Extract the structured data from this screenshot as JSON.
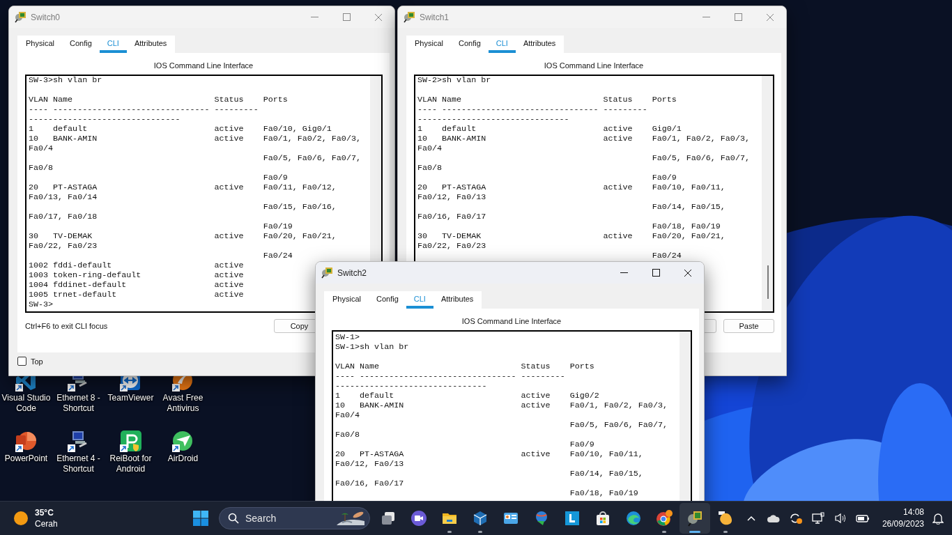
{
  "desktop": {
    "icons": [
      {
        "kind": "code-editor",
        "label": "Visual Studio Code"
      },
      {
        "kind": "network",
        "label": "Ethernet 8 - Shortcut"
      },
      {
        "kind": "remote",
        "label": "TeamViewer"
      },
      {
        "kind": "antivirus",
        "label": "Avast Free Antivirus"
      },
      {
        "kind": "slides",
        "label": "PowerPoint"
      },
      {
        "kind": "network",
        "label": "Ethernet 4 - Shortcut"
      },
      {
        "kind": "repair",
        "label": "ReiBoot for Android"
      },
      {
        "kind": "plane",
        "label": "AirDroid"
      }
    ]
  },
  "windows": [
    {
      "title": "Switch0",
      "active": false,
      "tabs": [
        {
          "label": "Physical",
          "selected": false
        },
        {
          "label": "Config",
          "selected": false
        },
        {
          "label": "CLI",
          "selected": true
        },
        {
          "label": "Attributes",
          "selected": false
        }
      ],
      "panel_title": "IOS Command Line Interface",
      "scrolled": true,
      "cli_lines": [
        {
          "text": "SW-3>sh vlan br"
        },
        {
          "vlan": "VLAN",
          "name": "Name",
          "status": "Status",
          "ports": "Ports"
        },
        {
          "text": "---- -------------------------------- ---------"
        },
        {
          "text": "-------------------------------"
        },
        {
          "vlan": "1",
          "name": "default",
          "status": "active",
          "ports": "Fa0/10, Gig0/1"
        },
        {
          "vlan": "10",
          "name": "BANK-AMIN",
          "status": "active",
          "ports": "Fa0/1, Fa0/2, Fa0/3,"
        },
        {
          "text": "Fa0/4"
        },
        {
          "ports": "Fa0/5, Fa0/6, Fa0/7,"
        },
        {
          "text": "Fa0/8"
        },
        {
          "ports": "Fa0/9"
        },
        {
          "vlan": "20",
          "name": "PT-ASTAGA",
          "status": "active",
          "ports": "Fa0/11, Fa0/12,"
        },
        {
          "text": "Fa0/13, Fa0/14"
        },
        {
          "ports": "Fa0/15, Fa0/16,"
        },
        {
          "text": "Fa0/17, Fa0/18"
        },
        {
          "ports": "Fa0/19"
        },
        {
          "vlan": "30",
          "name": "TV-DEMAK",
          "status": "active",
          "ports": "Fa0/20, Fa0/21,"
        },
        {
          "text": "Fa0/22, Fa0/23"
        },
        {
          "ports": "Fa0/24"
        },
        {
          "vlan": "1002",
          "name": "fddi-default",
          "status": "active"
        },
        {
          "vlan": "1003",
          "name": "token-ring-default",
          "status": "active"
        },
        {
          "vlan": "1004",
          "name": "fddinet-default",
          "status": "active"
        },
        {
          "vlan": "1005",
          "name": "trnet-default",
          "status": "active"
        },
        {
          "text": "SW-3>"
        }
      ],
      "hint": "Ctrl+F6 to exit CLI focus",
      "copy_button": "Copy",
      "top_checkbox": {
        "label": "Top",
        "checked": false
      }
    },
    {
      "title": "Switch1",
      "active": false,
      "tabs": [
        {
          "label": "Physical",
          "selected": false
        },
        {
          "label": "Config",
          "selected": false
        },
        {
          "label": "CLI",
          "selected": true
        },
        {
          "label": "Attributes",
          "selected": false
        }
      ],
      "panel_title": "IOS Command Line Interface",
      "scrolled": true,
      "cli_lines": [
        {
          "text": "SW-2>sh vlan br"
        },
        {
          "vlan": "VLAN",
          "name": "Name",
          "status": "Status",
          "ports": "Ports"
        },
        {
          "text": "---- -------------------------------- ---------"
        },
        {
          "text": "-------------------------------"
        },
        {
          "vlan": "1",
          "name": "default",
          "status": "active",
          "ports": "Gig0/1"
        },
        {
          "vlan": "10",
          "name": "BANK-AMIN",
          "status": "active",
          "ports": "Fa0/1, Fa0/2, Fa0/3,"
        },
        {
          "text": "Fa0/4"
        },
        {
          "ports": "Fa0/5, Fa0/6, Fa0/7,"
        },
        {
          "text": "Fa0/8"
        },
        {
          "ports": "Fa0/9"
        },
        {
          "vlan": "20",
          "name": "PT-ASTAGA",
          "status": "active",
          "ports": "Fa0/10, Fa0/11,"
        },
        {
          "text": "Fa0/12, Fa0/13"
        },
        {
          "ports": "Fa0/14, Fa0/15,"
        },
        {
          "text": "Fa0/16, Fa0/17"
        },
        {
          "ports": "Fa0/18, Fa0/19"
        },
        {
          "vlan": "30",
          "name": "TV-DEMAK",
          "status": "active",
          "ports": "Fa0/20, Fa0/21,"
        },
        {
          "text": "Fa0/22, Fa0/23"
        },
        {
          "ports": "Fa0/24"
        }
      ],
      "paste_button": "Paste"
    },
    {
      "title": "Switch2",
      "active": true,
      "tabs": [
        {
          "label": "Physical",
          "selected": false
        },
        {
          "label": "Config",
          "selected": false
        },
        {
          "label": "CLI",
          "selected": true
        },
        {
          "label": "Attributes",
          "selected": false
        }
      ],
      "panel_title": "IOS Command Line Interface",
      "scrolled": false,
      "cli_lines": [
        {
          "text": "SW-1>"
        },
        {
          "text": "SW-1>sh vlan br"
        },
        {
          "vlan": "VLAN",
          "name": "Name",
          "status": "Status",
          "ports": "Ports"
        },
        {
          "text": "---- -------------------------------- ---------"
        },
        {
          "text": "-------------------------------"
        },
        {
          "vlan": "1",
          "name": "default",
          "status": "active",
          "ports": "Gig0/2"
        },
        {
          "vlan": "10",
          "name": "BANK-AMIN",
          "status": "active",
          "ports": "Fa0/1, Fa0/2, Fa0/3,"
        },
        {
          "text": "Fa0/4"
        },
        {
          "ports": "Fa0/5, Fa0/6, Fa0/7,"
        },
        {
          "text": "Fa0/8"
        },
        {
          "ports": "Fa0/9"
        },
        {
          "vlan": "20",
          "name": "PT-ASTAGA",
          "status": "active",
          "ports": "Fa0/10, Fa0/11,"
        },
        {
          "text": "Fa0/12, Fa0/13"
        },
        {
          "ports": "Fa0/14, Fa0/15,"
        },
        {
          "text": "Fa0/16, Fa0/17"
        },
        {
          "ports": "Fa0/18, Fa0/19"
        }
      ]
    }
  ],
  "taskbar": {
    "weather": {
      "temperature": "35°C",
      "condition": "Cerah"
    },
    "search": {
      "placeholder": "Search"
    },
    "apps": [
      {
        "kind": "task-view",
        "running": false,
        "active": false
      },
      {
        "kind": "video",
        "running": false,
        "active": false
      },
      {
        "kind": "folder",
        "running": true,
        "active": false
      },
      {
        "kind": "cube",
        "running": true,
        "active": false
      },
      {
        "kind": "panel",
        "running": false,
        "active": false
      },
      {
        "kind": "globe",
        "running": false,
        "active": false
      },
      {
        "kind": "letter-tile",
        "running": false,
        "active": false
      },
      {
        "kind": "store",
        "running": false,
        "active": false
      },
      {
        "kind": "browser-wave",
        "running": false,
        "active": false
      },
      {
        "kind": "browser-ring",
        "running": true,
        "active": false
      },
      {
        "kind": "network-tool",
        "running": true,
        "active": true
      },
      {
        "kind": "blob",
        "running": true,
        "active": false
      }
    ],
    "clock": {
      "time": "14:08",
      "date": "26/09/2023"
    }
  }
}
